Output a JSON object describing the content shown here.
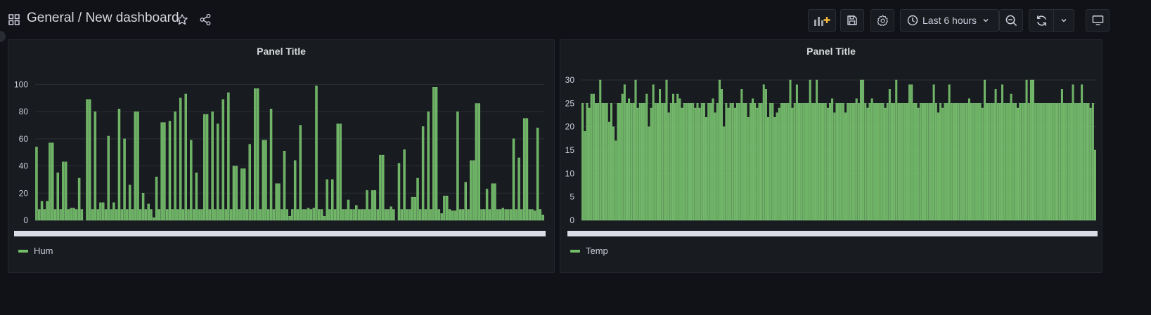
{
  "header": {
    "folder": "General",
    "separator": " / ",
    "title": "New dashboard",
    "time_range": "Last 6 hours"
  },
  "colors": {
    "series": "#73bf69",
    "bg": "#111217",
    "panel": "#181b1f"
  },
  "icons": [
    "apps-icon",
    "star-icon",
    "share-icon",
    "add-panel-icon",
    "save-icon",
    "gear-icon",
    "clock-icon",
    "chevron-down-icon",
    "zoom-out-icon",
    "refresh-icon",
    "tv-icon"
  ],
  "panels": [
    {
      "title": "Panel Title",
      "legend": "Hum",
      "y_ticks": [
        "0",
        "20",
        "40",
        "60",
        "80",
        "100"
      ]
    },
    {
      "title": "Panel Title",
      "legend": "Temp",
      "y_ticks": [
        "0",
        "5",
        "10",
        "15",
        "20",
        "25",
        "30"
      ]
    }
  ],
  "chart_data": [
    {
      "type": "bar",
      "title": "Panel Title",
      "ylim": [
        0,
        110
      ],
      "series": [
        {
          "name": "Hum",
          "values": [
            54,
            8,
            14,
            8,
            14,
            57,
            57,
            8,
            35,
            8,
            43,
            43,
            8,
            9,
            9,
            8,
            31,
            8,
            0,
            89,
            89,
            8,
            80,
            8,
            13,
            13,
            8,
            62,
            8,
            13,
            8,
            82,
            8,
            60,
            8,
            26,
            8,
            80,
            80,
            8,
            20,
            8,
            12,
            8,
            2,
            32,
            8,
            72,
            72,
            8,
            73,
            8,
            80,
            8,
            90,
            8,
            93,
            8,
            59,
            8,
            35,
            8,
            8,
            78,
            78,
            8,
            80,
            8,
            71,
            8,
            89,
            8,
            94,
            8,
            40,
            40,
            8,
            38,
            38,
            8,
            56,
            8,
            97,
            97,
            8,
            59,
            59,
            8,
            82,
            8,
            27,
            27,
            8,
            51,
            8,
            3,
            8,
            44,
            8,
            70,
            8,
            8,
            9,
            8,
            9,
            99,
            8,
            8,
            3,
            30,
            8,
            30,
            8,
            71,
            71,
            8,
            8,
            15,
            8,
            8,
            11,
            8,
            8,
            8,
            22,
            8,
            22,
            22,
            8,
            48,
            48,
            8,
            8,
            10,
            8,
            0,
            42,
            8,
            52,
            8,
            8,
            17,
            17,
            31,
            8,
            69,
            8,
            80,
            8,
            98,
            98,
            8,
            5,
            18,
            18,
            8,
            7,
            7,
            80,
            8,
            8,
            28,
            8,
            44,
            44,
            86,
            86,
            8,
            8,
            23,
            8,
            27,
            27,
            8,
            8,
            9,
            8,
            8,
            8,
            60,
            8,
            46,
            8,
            75,
            75,
            8,
            8,
            7,
            68,
            8,
            4
          ]
        }
      ]
    },
    {
      "type": "bar",
      "title": "Panel Title",
      "ylim": [
        0,
        32
      ],
      "series": [
        {
          "name": "Temp",
          "values": [
            25,
            19,
            25,
            24,
            27,
            27,
            25,
            25,
            30,
            25,
            25,
            25,
            21,
            25,
            20,
            17,
            25,
            25,
            27,
            29,
            25,
            26,
            25,
            25,
            30,
            24,
            25,
            25,
            25,
            27,
            20,
            24,
            29,
            25,
            25,
            28,
            25,
            25,
            30,
            23,
            25,
            27,
            25,
            27,
            26,
            24,
            25,
            25,
            25,
            25,
            25,
            24,
            25,
            24,
            25,
            25,
            22,
            25,
            25,
            26,
            23,
            25,
            30,
            28,
            20,
            25,
            24,
            25,
            25,
            24,
            25,
            25,
            28,
            25,
            25,
            22,
            25,
            26,
            25,
            24,
            25,
            25,
            29,
            28,
            22,
            25,
            25,
            22,
            23,
            24,
            25,
            25,
            25,
            25,
            30,
            24,
            25,
            29,
            25,
            25,
            25,
            25,
            25,
            30,
            25,
            25,
            30,
            25,
            25,
            25,
            25,
            24,
            25,
            26,
            23,
            25,
            25,
            25,
            25,
            23,
            25,
            25,
            25,
            25,
            26,
            25,
            30,
            30,
            25,
            24,
            25,
            26,
            25,
            25,
            25,
            25,
            25,
            24,
            25,
            28,
            25,
            25,
            30,
            25,
            25,
            25,
            25,
            25,
            29,
            29,
            25,
            25,
            24,
            25,
            25,
            25,
            25,
            25,
            25,
            29,
            25,
            23,
            25,
            24,
            25,
            25,
            29,
            25,
            25,
            25,
            25,
            25,
            25,
            25,
            25,
            26,
            25,
            25,
            25,
            25,
            25,
            24,
            30,
            25,
            25,
            25,
            25,
            28,
            25,
            25,
            29,
            25,
            25,
            25,
            27,
            25,
            25,
            24,
            25,
            25,
            25,
            30,
            25,
            30,
            30,
            25,
            25,
            25,
            25,
            25,
            25,
            25,
            25,
            25,
            25,
            25,
            25,
            28,
            25,
            25,
            25,
            25,
            29,
            25,
            25,
            25,
            29,
            25,
            25,
            25,
            24,
            25,
            15
          ]
        }
      ]
    }
  ]
}
